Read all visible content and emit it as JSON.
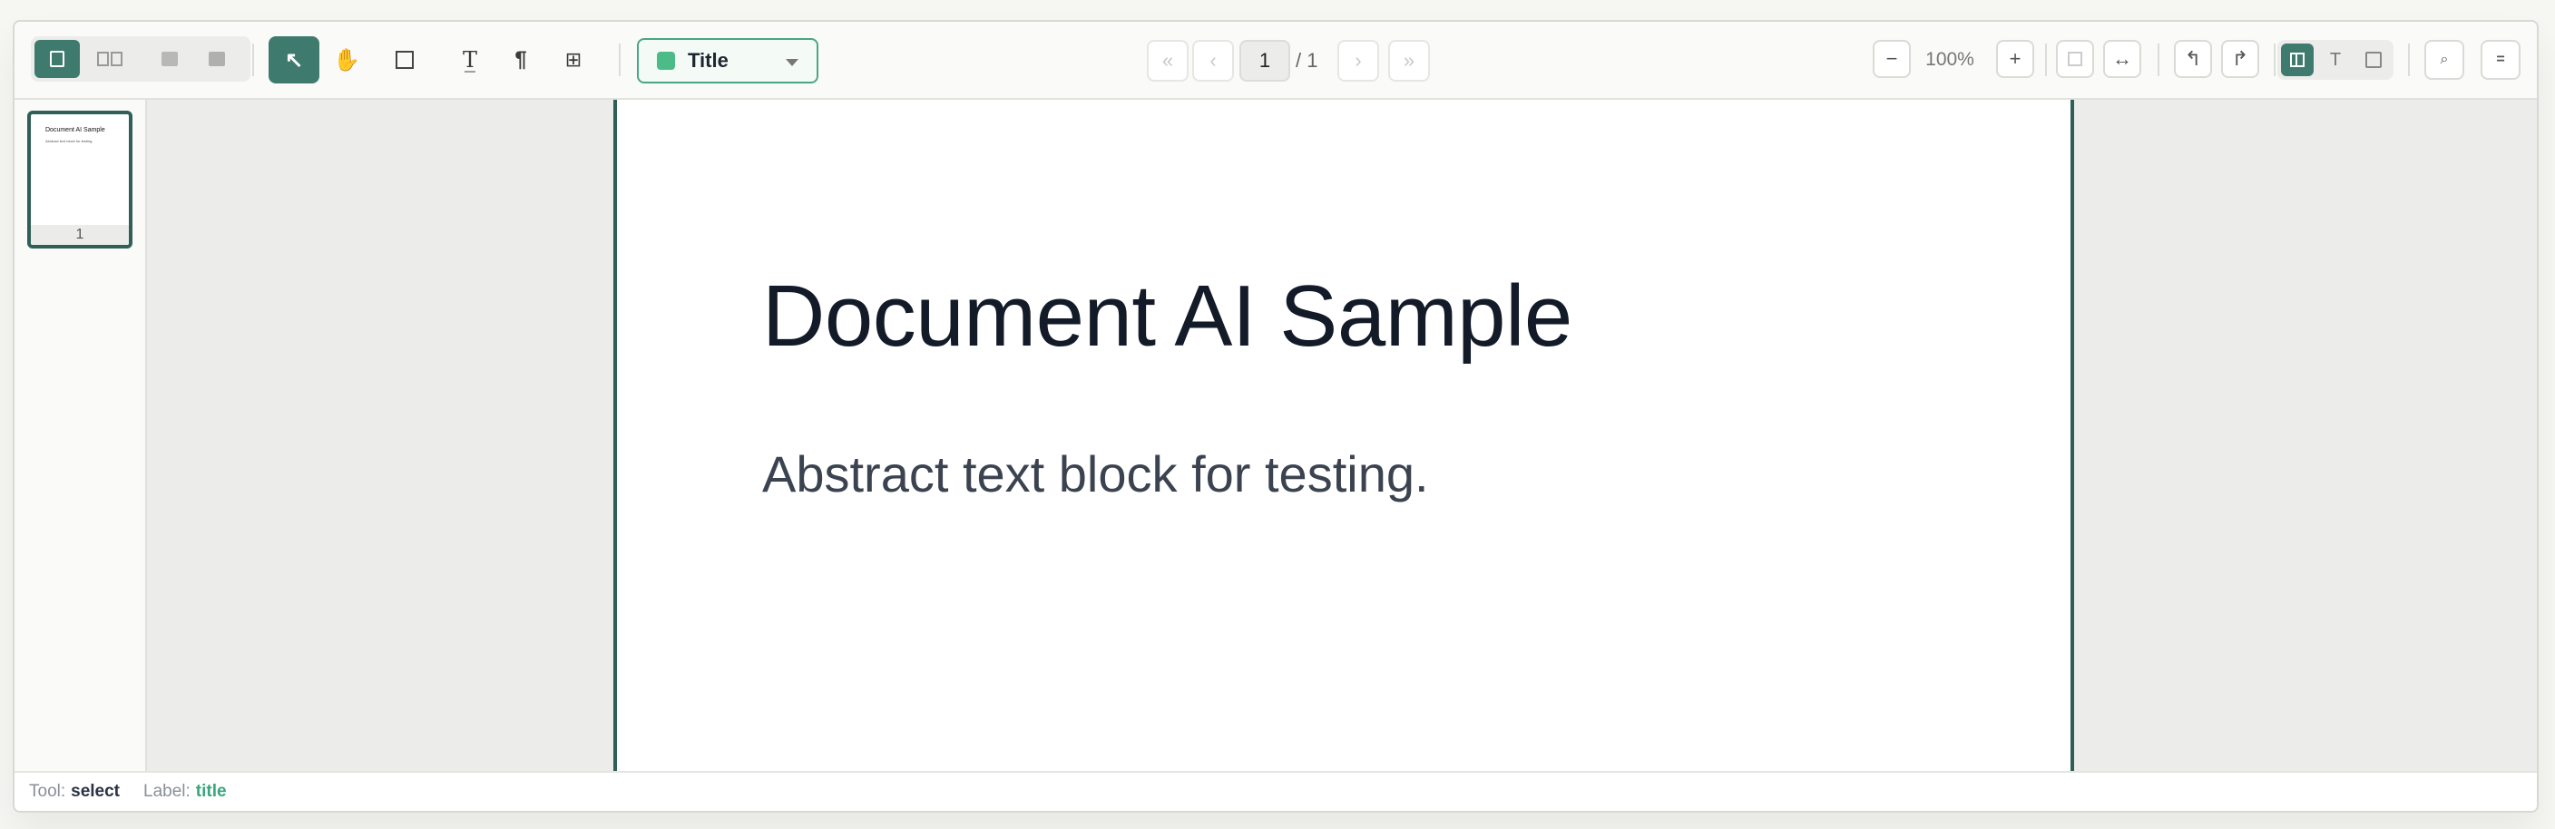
{
  "toolbar": {
    "label_dropdown": {
      "value": "Title",
      "swatch_color": "#4dbb87"
    },
    "pagination": {
      "current_page": "1",
      "total_label": "/ 1"
    },
    "zoom": {
      "level": "100%",
      "minus": "−",
      "plus": "+"
    },
    "tools": [
      {
        "name": "select",
        "icon": "cursor-arrow-icon",
        "glyph": "↖",
        "active": true
      },
      {
        "name": "pan",
        "icon": "hand-icon",
        "glyph": "✋",
        "active": false
      },
      {
        "name": "rectangle",
        "icon": "rectangle-icon",
        "glyph": "",
        "active": false
      },
      {
        "name": "text",
        "icon": "text-tool-icon",
        "glyph": "T̲",
        "active": false
      },
      {
        "name": "paragraph",
        "icon": "paragraph-icon",
        "glyph": "¶",
        "active": false
      },
      {
        "name": "table",
        "icon": "table-icon",
        "glyph": "⊞",
        "active": false
      }
    ],
    "nav_glyphs": {
      "first": "«",
      "prev": "‹",
      "next": "›",
      "last": "»"
    },
    "fit_glyphs": {
      "fit_width": "↔"
    },
    "rotate_glyphs": {
      "left": "↰",
      "right": "↱"
    },
    "view_mode_glyphs": {
      "text": "T"
    },
    "search_glyph": "⌕",
    "menu_glyph": "="
  },
  "sidebar": {
    "thumbnails": [
      {
        "title": "Document AI Sample",
        "subtitle": "Abstract text block for testing.",
        "page_number": "1"
      }
    ]
  },
  "document": {
    "title": "Document AI Sample",
    "abstract": "Abstract text block for testing."
  },
  "status": {
    "tool_key": "Tool:",
    "tool_value": "select",
    "label_key": "Label:",
    "label_value": "title"
  },
  "colors": {
    "accent": "#3f7a6e",
    "page_border": "#2f5f57",
    "label_green": "#4dbb87"
  }
}
